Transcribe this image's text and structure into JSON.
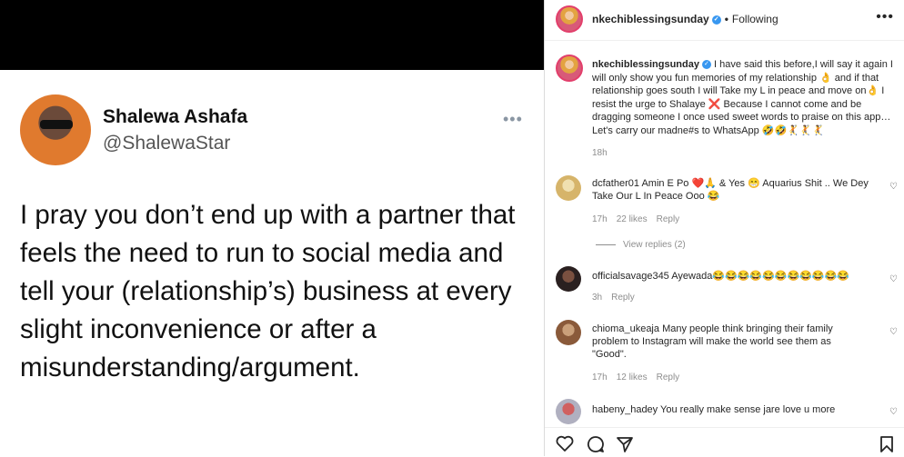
{
  "tweet": {
    "name": "Shalewa Ashafa",
    "handle": "@ShalewaStar",
    "more": "•••",
    "text": "I pray you don’t end up with a partner that feels the need to run to social media and tell your (relationship’s) business at every slight inconvenience or after a misunderstanding/argument.",
    "faded_left": "",
    "faded_right": ""
  },
  "post": {
    "username": "nkechiblessingsunday",
    "verified": "✓",
    "following": "Following",
    "more": "•••",
    "caption": "I have said this before,I will say it again I will only show you fun memories of my relationship 👌 and if that relationship goes south I will Take my L in peace and move on👌 I resist the urge to Shalaye ❌ Because I cannot come and be dragging someone I once used sweet words to praise on this app…Let's carry our madne#s to WhatsApp 🤣🤣🤾🤾🤾",
    "time": "18h"
  },
  "comments": [
    {
      "user": "dcfather01",
      "text": "Amin E Po ❤️🙏 & Yes 😁 Aquarius Shit .. We Dey Take Our L In Peace Ooo 😂",
      "time": "17h",
      "likes": "22 likes",
      "reply": "Reply"
    },
    {
      "user": "officialsavage345",
      "text": "Ayewada😂😂😂😂😂😂😂😂😂😂😂",
      "time": "3h",
      "likes": "",
      "reply": "Reply"
    },
    {
      "user": "chioma_ukeaja",
      "text": "Many people think bringing their family problem to Instagram will make the world see them as \"Good\".",
      "time": "17h",
      "likes": "12 likes",
      "reply": "Reply"
    },
    {
      "user": "habeny_hadey",
      "text": "You really make sense jare love u more",
      "time": "",
      "likes": "",
      "reply": ""
    }
  ],
  "view_replies": "View replies (2)",
  "icons": {
    "heart": "heart-icon",
    "comment": "comment-icon",
    "share": "share-icon",
    "save": "bookmark-icon"
  },
  "colors": {
    "verified": "#3897f0",
    "muted": "#8e8e8e",
    "text": "#262626"
  }
}
